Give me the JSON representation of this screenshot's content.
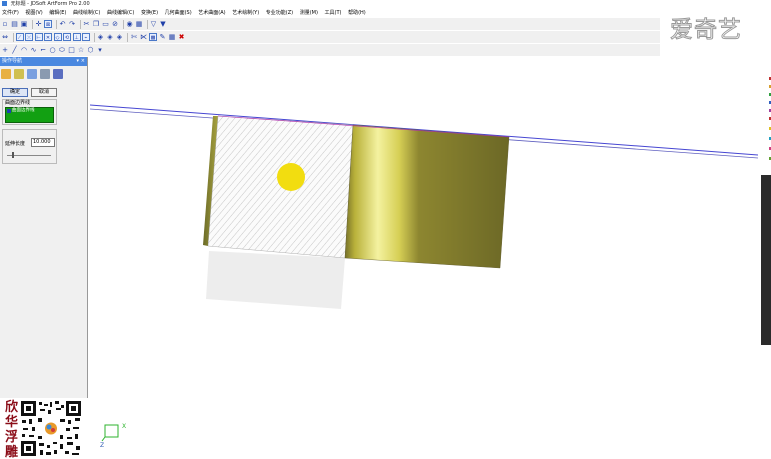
{
  "window": {
    "title": "无标题 - JDSoft ArtForm Pro 2.00"
  },
  "menu": [
    "文件(F)",
    "视图(V)",
    "编辑(E)",
    "曲线绘制(C)",
    "曲线编辑(C)",
    "变换(E)",
    "几何曲面(S)",
    "艺术曲面(A)",
    "艺术绘制(Y)",
    "专业功能(Z)",
    "测量(M)",
    "工具(T)",
    "帮助(H)"
  ],
  "panel": {
    "title": "操作导航",
    "pin_glyph": "▾",
    "close_glyph": "×",
    "ok_label": "确定",
    "cancel_label": "取消",
    "group_label": "曲面边界线",
    "group_item": "曲面边界线",
    "param_label": "延伸长度",
    "param_value": "10.000"
  },
  "branding": {
    "watermark": "爱奇艺",
    "side_text": "欣华浮雕"
  },
  "viewport": {
    "axis_x": "X",
    "axis_z": "Z"
  },
  "colors": {
    "accent": "#4a88e0",
    "list_green": "#12a012",
    "gold_light": "#f4f2a0",
    "gold_mid": "#c7c13a",
    "gold_dark": "#75702a",
    "marker_yellow": "#f2dd10",
    "edge_line": "#4646d2",
    "qr_text": "#8b0d18"
  }
}
